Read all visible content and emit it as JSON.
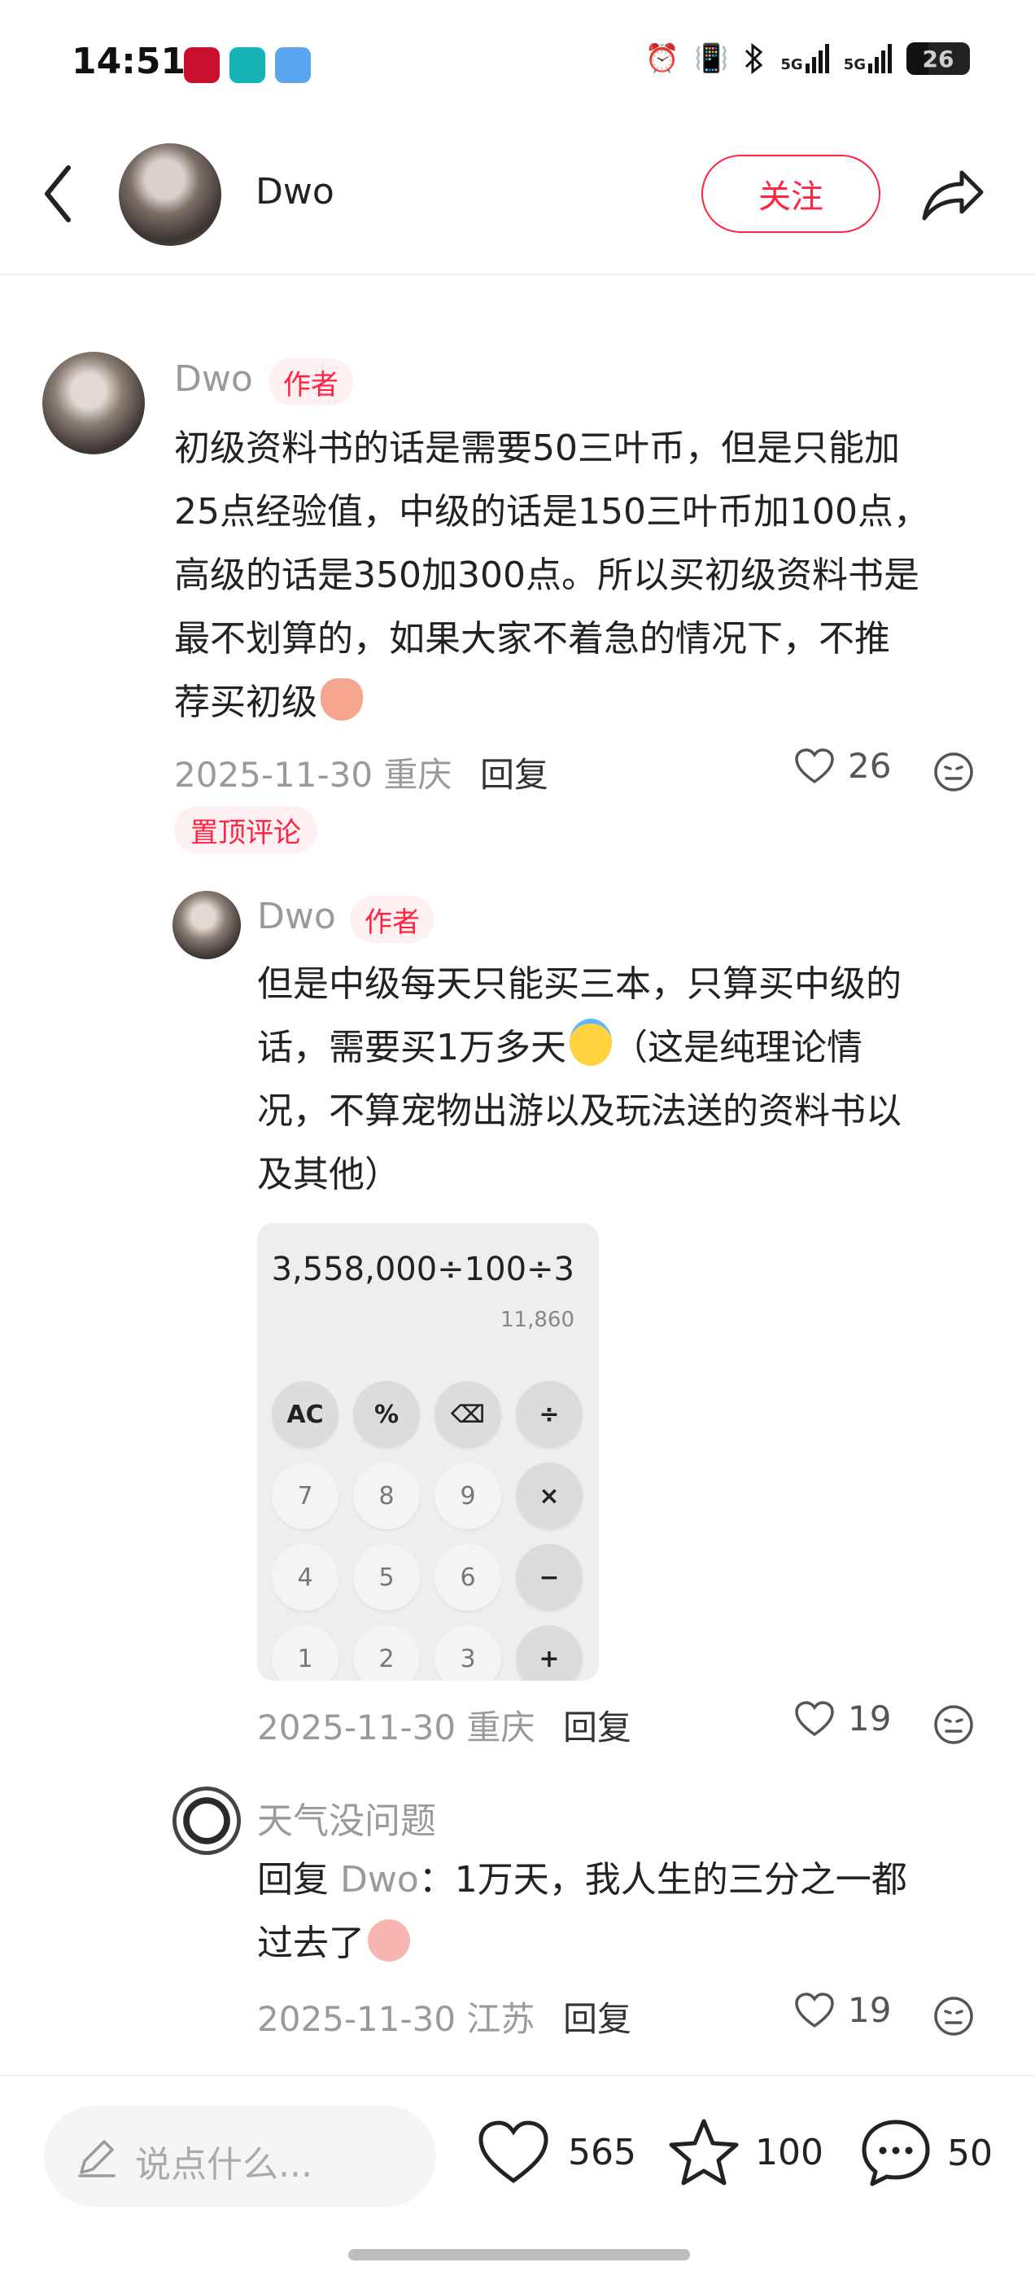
{
  "status_bar": {
    "time": "14:51",
    "battery": "26",
    "net1": "5G",
    "net2": "5G"
  },
  "header": {
    "author_name": "Dwo",
    "follow_label": "关注"
  },
  "comments": [
    {
      "name": "Dwo",
      "tag": "作者",
      "lines": [
        "初级资料书的话是需要50三叶币，但是只能加",
        "25点经验值，中级的话是150三叶币加100点，",
        "高级的话是350加300点。所以买初级资料书是",
        "最不划算的，如果大家不着急的情况下，不推",
        "荐买初级"
      ],
      "date_loc": "2025-11-30 重庆",
      "reply_label": "回复",
      "likes": "26",
      "pinned_label": "置顶评论"
    },
    {
      "name": "Dwo",
      "tag": "作者",
      "lines": [
        "但是中级每天只能买三本，只算买中级的",
        "话，需要买1万多天",
        "况，不算宠物出游以及玩法送的资料书以",
        "及其他）"
      ],
      "line2_suffix": "（这是纯理论情",
      "date_loc": "2025-11-30 重庆",
      "reply_label": "回复",
      "likes": "19"
    },
    {
      "name": "天气没问题",
      "reply_prefix": "回复",
      "reply_target": "Dwo",
      "reply_text": "：1万天，我人生的三分之一都",
      "line2": "过去了",
      "date_loc": "2025-11-30 江苏",
      "reply_label": "回复",
      "likes": "19"
    }
  ],
  "calculator": {
    "expression": "3,558,000÷100÷3",
    "result": "11,860",
    "keys": [
      "AC",
      "%",
      "⌫",
      "÷",
      "7",
      "8",
      "9",
      "×",
      "4",
      "5",
      "6",
      "−",
      "1",
      "2",
      "3",
      "+"
    ]
  },
  "bottom_bar": {
    "input_placeholder": "说点什么...",
    "like_count": "565",
    "star_count": "100",
    "comment_count": "50"
  },
  "colors": {
    "accent": "#ff2442",
    "muted": "#9a9a9a"
  }
}
